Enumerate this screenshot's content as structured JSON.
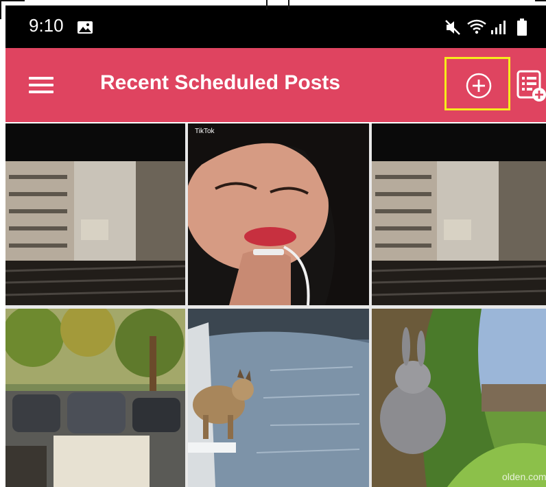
{
  "status_bar": {
    "time": "9:10",
    "icons": [
      "gallery-icon",
      "mute-icon",
      "wifi-icon",
      "signal-icon",
      "battery-icon"
    ]
  },
  "app_bar": {
    "title": "Recent Scheduled Posts",
    "background": "#df4460",
    "highlight_color": "#f6ec1c",
    "icons": [
      "menu-icon",
      "add-post-icon",
      "schedule-list-icon"
    ]
  },
  "posts": {
    "items": [
      {
        "thumbnail": "building-through-window"
      },
      {
        "thumbnail": "girl-with-earphones",
        "watermark": "TikTok"
      },
      {
        "thumbnail": "building-through-window"
      },
      {
        "thumbnail": "street-with-parked-cars"
      },
      {
        "thumbnail": "lynx-by-stream"
      },
      {
        "thumbnail": "cartoon-rabbit-on-grass",
        "watermark": "olden.com"
      }
    ]
  }
}
